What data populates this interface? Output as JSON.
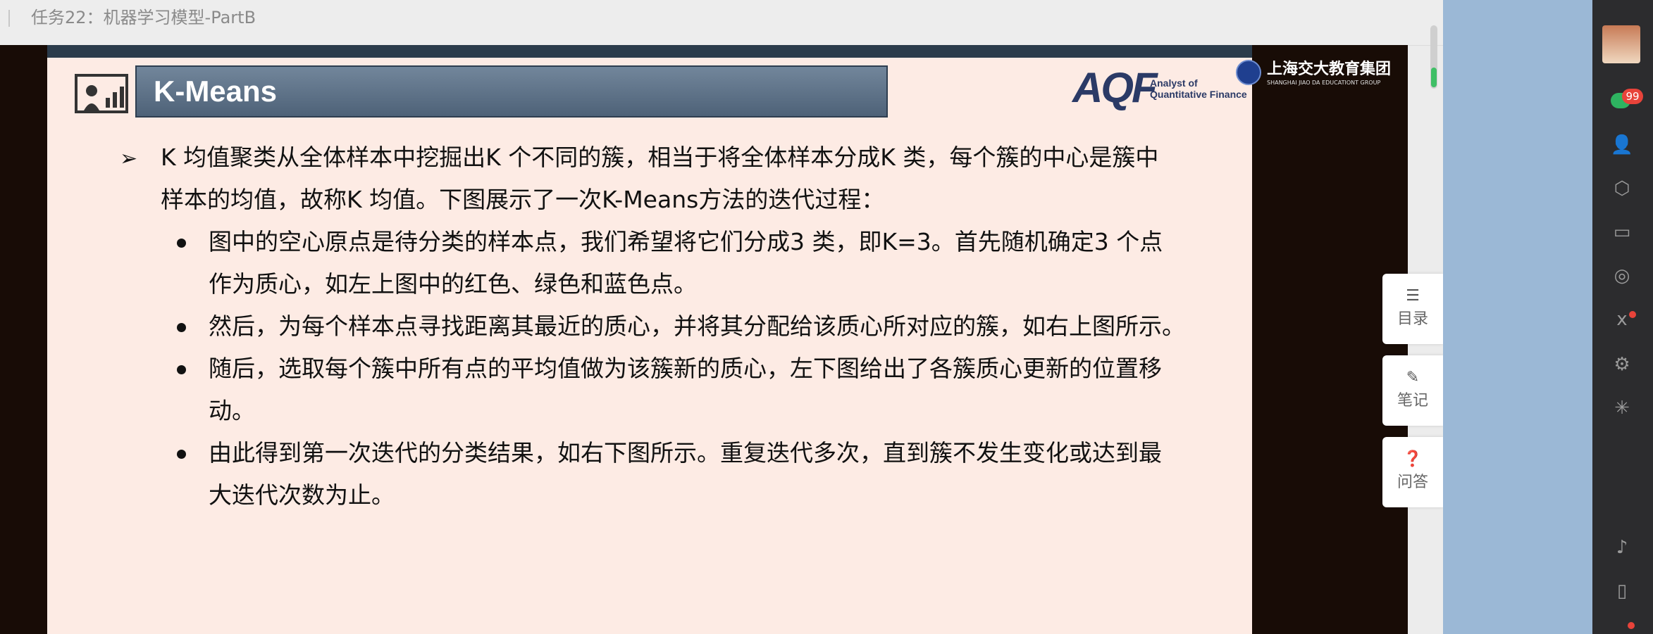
{
  "topbar": {
    "title": "任务22：机器学习模型-PartB"
  },
  "slide": {
    "title": "K-Means",
    "logo_aqf": "AQF",
    "logo_aqf_tag": [
      "Analyst of",
      "Quantitative Finance"
    ],
    "logo_sjtu": "上海交大教育集团",
    "logo_sjtu_sub": "SHANGHAI JIAO DA EDUCATIONT GROUP",
    "bullet_arrow": "➢",
    "main_lines": [
      "K  均值聚类从全体样本中挖掘出K  个不同的簇，相当于将全体样本分成K  类，每个簇的中心是簇中",
      "样本的均值，故称K 均值。下图展示了一次K-Means方法的迭代过程："
    ],
    "sub_items": [
      [
        "图中的空心原点是待分类的样本点，我们希望将它们分成3  类，即K=3。首先随机确定3  个点",
        "作为质心，如左上图中的红色、绿色和蓝色点。"
      ],
      [
        "然后，为每个样本点寻找距离其最近的质心，并将其分配给该质心所对应的簇，如右上图所示。"
      ],
      [
        "随后，选取每个簇中所有点的平均值做为该簇新的质心，左下图给出了各簇质心更新的位置移",
        "动。"
      ],
      [
        "由此得到第一次迭代的分类结果，如右下图所示。重复迭代多次，直到簇不发生变化或达到最",
        "大迭代次数为止。"
      ]
    ]
  },
  "side_panel": {
    "toc_label": "目录",
    "notes_label": "笔记",
    "qa_label": "问答"
  },
  "right_bar": {
    "chat_badge": "99",
    "icons": [
      "avatar",
      "chat-icon",
      "user-icon",
      "cube-icon",
      "folder-icon",
      "aperture-icon",
      "butterfly-icon",
      "settings-icon",
      "sparkle-icon",
      "music-icon",
      "phone-icon"
    ]
  }
}
